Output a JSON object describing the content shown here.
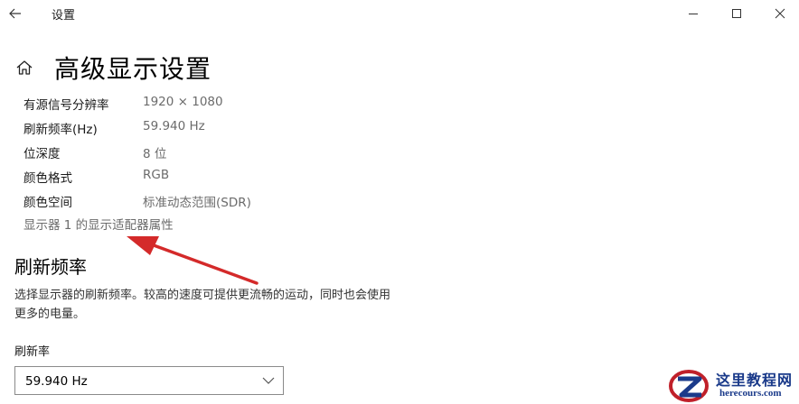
{
  "window": {
    "title": "设置",
    "back_icon": "arrow-left",
    "controls": [
      "minimize",
      "maximize",
      "close"
    ]
  },
  "header": {
    "home_icon": "home",
    "title": "高级显示设置"
  },
  "display_info": [
    {
      "label": "有源信号分辨率",
      "value": "1920 × 1080"
    },
    {
      "label": "刷新频率(Hz)",
      "value": "59.940 Hz"
    },
    {
      "label": "位深度",
      "value": "8 位"
    },
    {
      "label": "颜色格式",
      "value": "RGB"
    },
    {
      "label": "颜色空间",
      "value": "标准动态范围(SDR)"
    }
  ],
  "adapter_link": "显示器 1 的显示适配器属性",
  "refresh": {
    "title": "刷新频率",
    "description_line1": "选择显示器的刷新频率。较高的速度可提供更流畅的运动，同时也会使用",
    "description_line2": "更多的电量。",
    "field_label": "刷新率",
    "selected": "59.940 Hz"
  },
  "annotation": {
    "color": "#d42a2a"
  },
  "watermark": {
    "text": "这里教程网",
    "sub": "herecours.com"
  }
}
